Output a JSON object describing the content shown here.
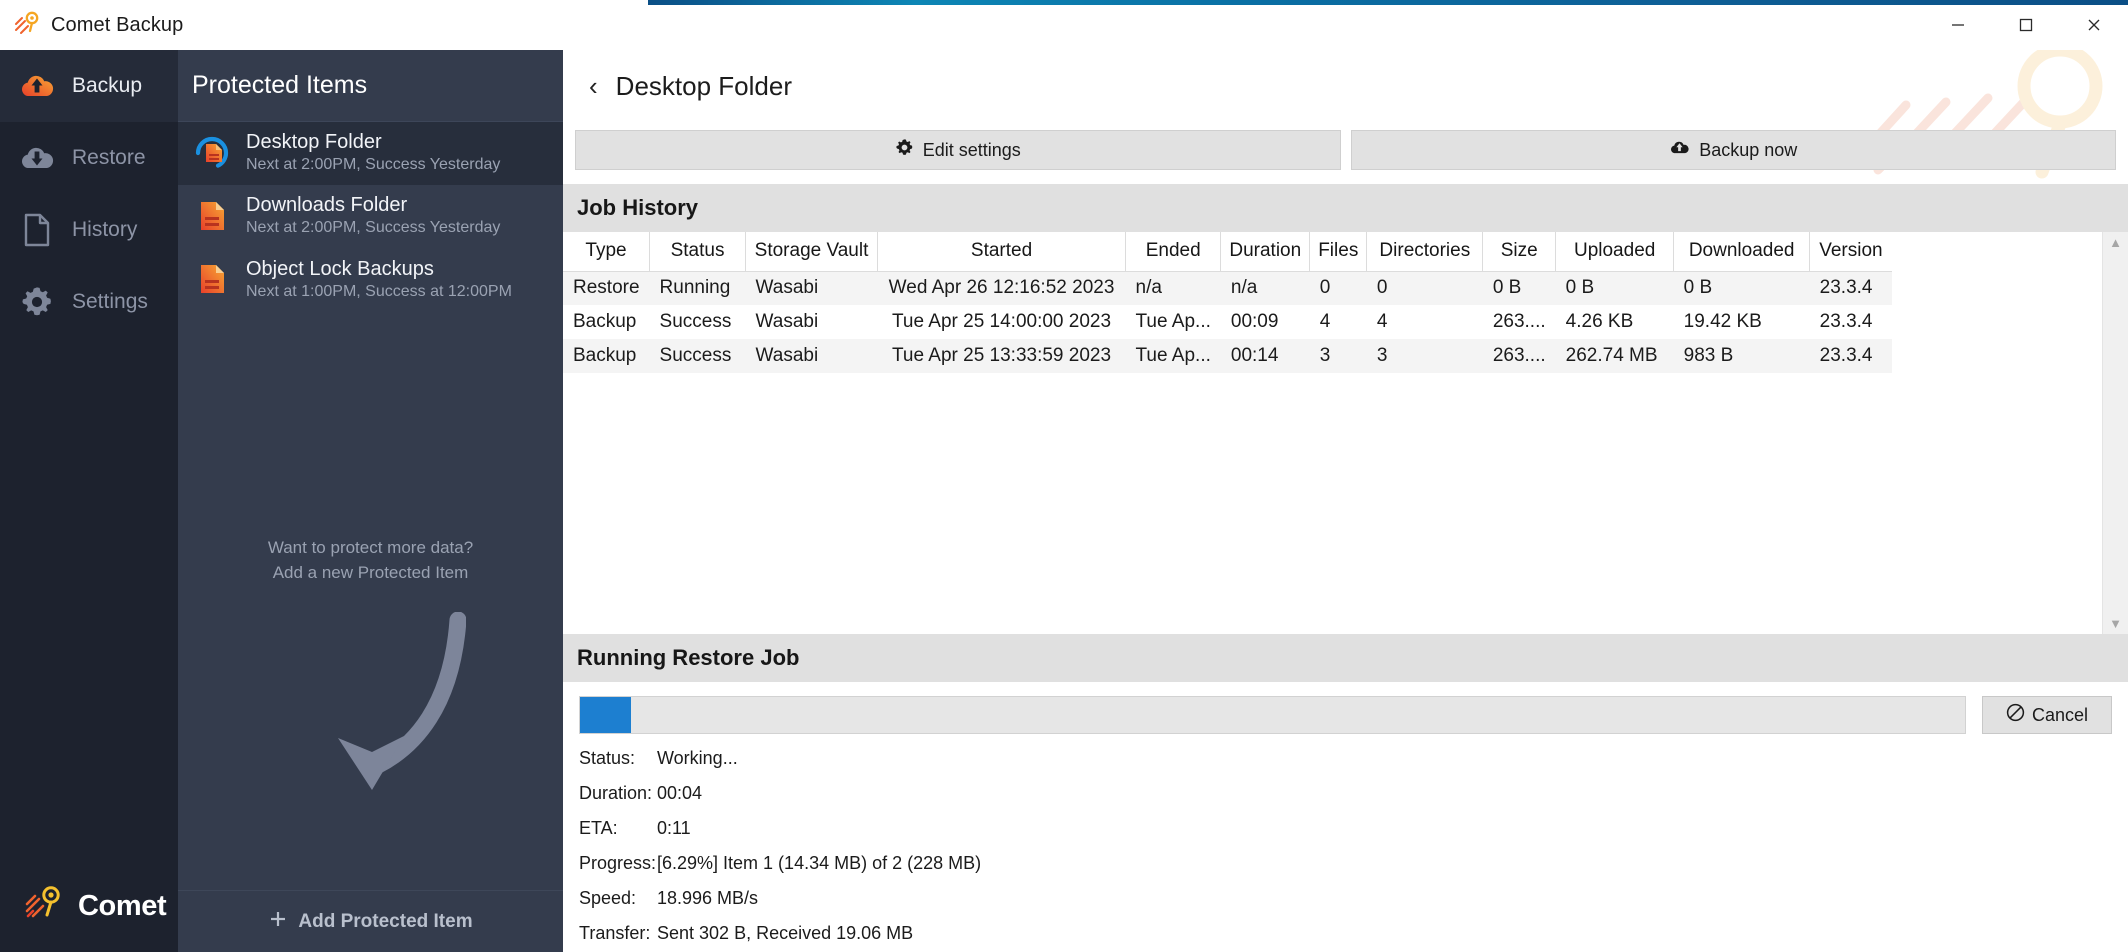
{
  "window": {
    "title": "Comet Backup",
    "controls": {
      "minimize": "minimize-button",
      "maximize": "maximize-button",
      "close": "close-button"
    }
  },
  "nav": {
    "items": [
      {
        "label": "Backup",
        "icon": "cloud-upload-icon",
        "active": true
      },
      {
        "label": "Restore",
        "icon": "cloud-download-icon",
        "active": false
      },
      {
        "label": "History",
        "icon": "document-icon",
        "active": false
      },
      {
        "label": "Settings",
        "icon": "gear-icon",
        "active": false
      }
    ],
    "brand": "Comet"
  },
  "protected_items": {
    "header": "Protected Items",
    "items": [
      {
        "title": "Desktop Folder",
        "subtitle": "Next at 2:00PM, Success Yesterday",
        "selected": true,
        "icon": "running-document-icon"
      },
      {
        "title": "Downloads Folder",
        "subtitle": "Next at 2:00PM, Success Yesterday",
        "selected": false,
        "icon": "document-icon"
      },
      {
        "title": "Object Lock Backups",
        "subtitle": "Next at 1:00PM, Success at 12:00PM",
        "selected": false,
        "icon": "document-icon"
      }
    ],
    "promo_line1": "Want to protect more data?",
    "promo_line2": "Add a new Protected Item",
    "add_label": "Add Protected Item"
  },
  "main": {
    "back_icon": "chevron-left-icon",
    "title": "Desktop Folder",
    "buttons": [
      {
        "label": "Edit settings",
        "icon": "gear-icon"
      },
      {
        "label": "Backup now",
        "icon": "cloud-upload-icon"
      }
    ]
  },
  "job_history": {
    "section_title": "Job History",
    "columns": [
      "Type",
      "Status",
      "Storage Vault",
      "Started",
      "Ended",
      "Duration",
      "Files",
      "Directories",
      "Size",
      "Uploaded",
      "Downloaded",
      "Version"
    ],
    "rows": [
      {
        "Type": "Restore",
        "Status": "Running",
        "Storage Vault": "Wasabi",
        "Started": "Wed Apr 26 12:16:52 2023",
        "Ended": "n/a",
        "Duration": "n/a",
        "Files": "0",
        "Directories": "0",
        "Size": "0 B",
        "Uploaded": "0 B",
        "Downloaded": "0 B",
        "Version": "23.3.4"
      },
      {
        "Type": "Backup",
        "Status": "Success",
        "Storage Vault": "Wasabi",
        "Started": "Tue Apr 25 14:00:00 2023",
        "Ended": "Tue Ap...",
        "Duration": "00:09",
        "Files": "4",
        "Directories": "4",
        "Size": "263....",
        "Uploaded": "4.26 KB",
        "Downloaded": "19.42 KB",
        "Version": "23.3.4"
      },
      {
        "Type": "Backup",
        "Status": "Success",
        "Storage Vault": "Wasabi",
        "Started": "Tue Apr 25 13:33:59 2023",
        "Ended": "Tue Ap...",
        "Duration": "00:14",
        "Files": "3",
        "Directories": "3",
        "Size": "263....",
        "Uploaded": "262.74 MB",
        "Downloaded": "983 B",
        "Version": "23.3.4"
      }
    ],
    "scrollbar": {
      "up": "▲",
      "down": "▼"
    }
  },
  "running_job": {
    "section_title": "Running Restore Job",
    "progress_percent": 6.29,
    "cancel_label": "Cancel",
    "cancel_icon": "no-entry-icon",
    "fields": [
      {
        "key": "Status:",
        "value": "Working..."
      },
      {
        "key": "Duration:",
        "value": "00:04"
      },
      {
        "key": "ETA:",
        "value": "0:11"
      },
      {
        "key": "Progress:",
        "value": "[6.29%] Item 1 (14.34 MB) of 2 (228 MB)"
      },
      {
        "key": "Speed:",
        "value": "18.996 MB/s"
      },
      {
        "key": "Transfer:",
        "value": "Sent 302 B, Received 19.06 MB"
      }
    ]
  },
  "colors": {
    "accent_blue": "#1d7fd0",
    "nav_bg": "#1d222e",
    "panel_bg": "#343c4d",
    "selected_bg": "#272e3c",
    "section_bg": "#e0e0e0",
    "comet_orange": "#f0632e",
    "comet_yellow": "#f5a623"
  }
}
